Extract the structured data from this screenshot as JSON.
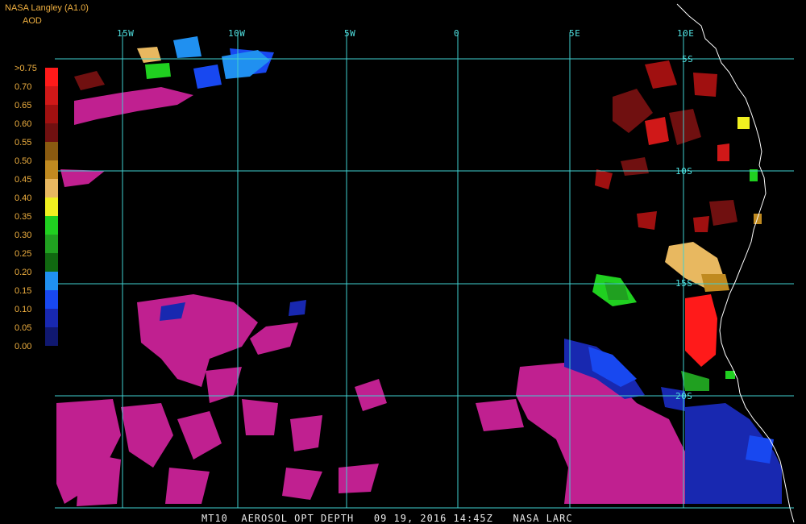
{
  "header": {
    "title": "NASA Langley (A1.0)",
    "product": "AOD"
  },
  "legend": {
    "labels": [
      ">0.75",
      "0.70",
      "0.65",
      "0.60",
      "0.55",
      "0.50",
      "0.45",
      "0.40",
      "0.35",
      "0.30",
      "0.25",
      "0.20",
      "0.15",
      "0.10",
      "0.05",
      "0.00"
    ],
    "colors": [
      "#ff1a1a",
      "#d01818",
      "#a01010",
      "#701010",
      "#8a5a10",
      "#c08a20",
      "#e8b860",
      "#f0f020",
      "#20d020",
      "#20a020",
      "#106810",
      "#2090f0",
      "#1848f0",
      "#1828b0",
      "#101870",
      "#c02090"
    ]
  },
  "grid": {
    "longitude_labels": [
      "15W",
      "10W",
      "5W",
      "0",
      "5E",
      "10E"
    ],
    "latitude_labels": [
      "5S",
      "10S",
      "15S",
      "20S"
    ]
  },
  "footer": {
    "caption": "MT10  AEROSOL OPT DEPTH   09 19, 2016 14:45Z   NASA LARC"
  },
  "colors": {
    "grid": "#40d0d0",
    "coastline": "#ffffff",
    "background": "#000000"
  }
}
